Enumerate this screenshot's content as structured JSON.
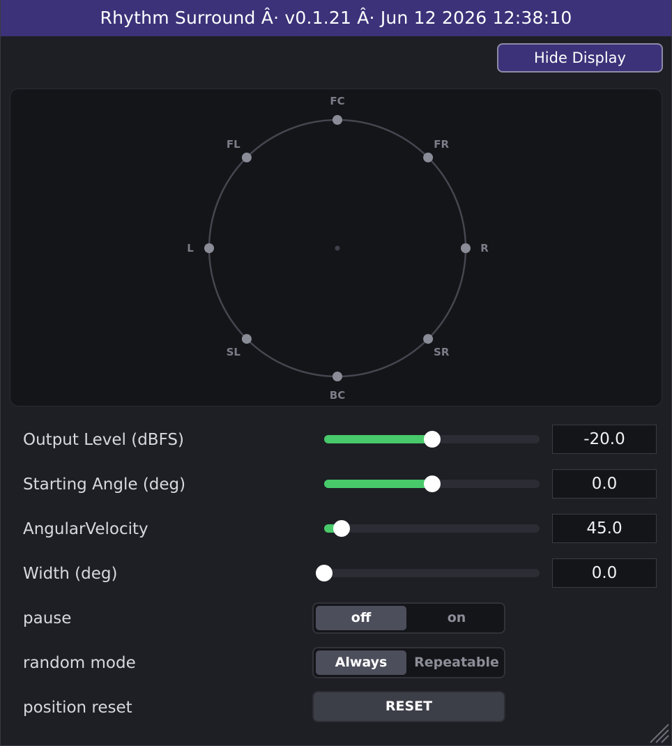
{
  "window": {
    "title": "Rhythm Surround  Â·  v0.1.21  Â·  Jun 12 2026 12:38:10"
  },
  "header": {
    "hide_display_label": "Hide Display"
  },
  "display": {
    "speakers": [
      {
        "label": "FC",
        "angle_deg": 0
      },
      {
        "label": "FR",
        "angle_deg": 45
      },
      {
        "label": "R",
        "angle_deg": 90
      },
      {
        "label": "SR",
        "angle_deg": 135
      },
      {
        "label": "BC",
        "angle_deg": 180
      },
      {
        "label": "SL",
        "angle_deg": 225
      },
      {
        "label": "L",
        "angle_deg": 270
      },
      {
        "label": "FL",
        "angle_deg": 315
      }
    ]
  },
  "controls": {
    "output_level": {
      "label": "Output Level (dBFS)",
      "value": "-20.0",
      "slider_fraction": 0.5
    },
    "starting_angle": {
      "label": "Starting Angle (deg)",
      "value": "0.0",
      "slider_fraction": 0.5
    },
    "angular_velocity": {
      "label": "AngularVelocity",
      "value": "45.0",
      "slider_fraction": 0.08
    },
    "width": {
      "label": "Width (deg)",
      "value": "0.0",
      "slider_fraction": 0.0
    },
    "pause": {
      "label": "pause",
      "options": [
        "off",
        "on"
      ],
      "selected": "off"
    },
    "random_mode": {
      "label": "random mode",
      "options": [
        "Always",
        "Repeatable"
      ],
      "selected": "Always"
    },
    "position_reset": {
      "label": "position reset",
      "button_label": "RESET"
    }
  },
  "colors": {
    "accent": "#3b3279",
    "slider_fill": "#48c96a",
    "speaker_dot": "#8a8c97"
  }
}
